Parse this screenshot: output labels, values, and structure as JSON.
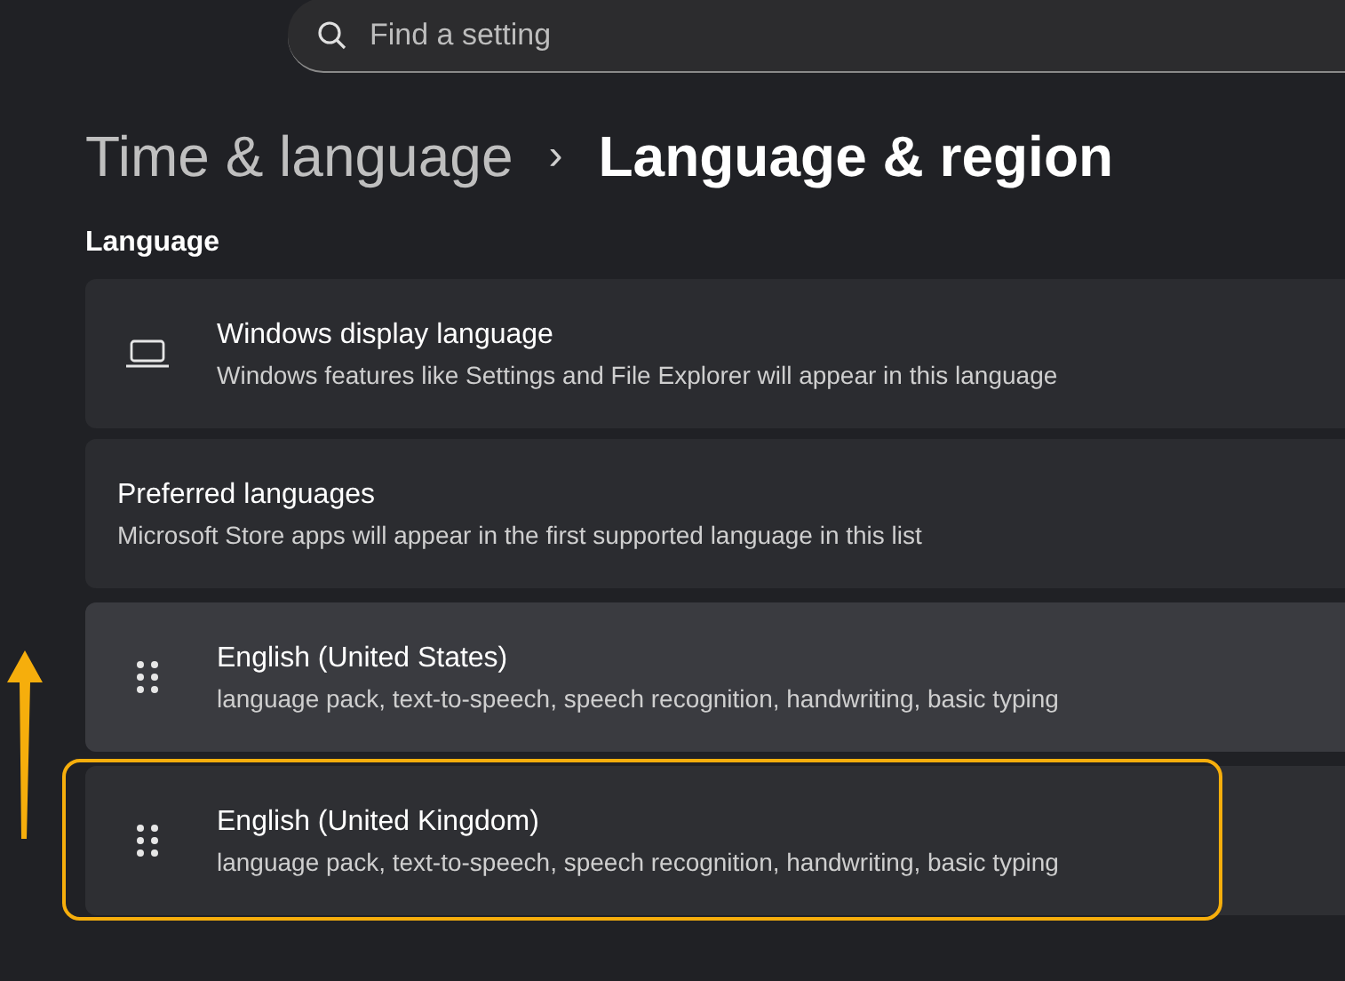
{
  "search": {
    "placeholder": "Find a setting"
  },
  "breadcrumb": {
    "parent": "Time & language",
    "separator": "›",
    "current": "Language & region"
  },
  "section_title": "Language",
  "settings": [
    {
      "kind": "icon",
      "title": "Windows display language",
      "description": "Windows features like Settings and File Explorer will appear in this language"
    },
    {
      "kind": "plain",
      "title": "Preferred languages",
      "description": "Microsoft Store apps will appear in the first supported language in this list"
    }
  ],
  "languages": [
    {
      "name": "English (United States)",
      "features": "language pack, text-to-speech, speech recognition, handwriting, basic typing",
      "hovered": true,
      "highlighted": false
    },
    {
      "name": "English (United Kingdom)",
      "features": "language pack, text-to-speech, speech recognition, handwriting, basic typing",
      "hovered": false,
      "highlighted": true
    }
  ],
  "annotation_arrow": true
}
